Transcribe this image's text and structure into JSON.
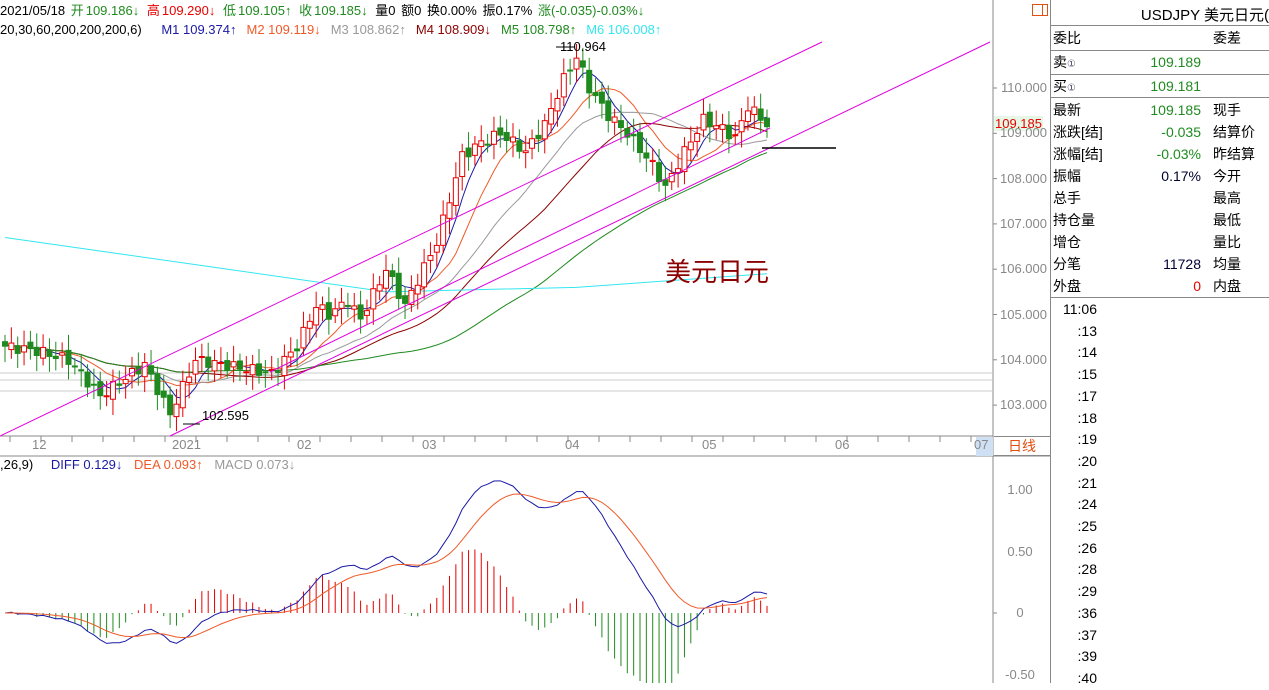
{
  "header": {
    "date": "2021/05/18",
    "open_label": "开",
    "open": "109.186↓",
    "high_label": "高",
    "high": "109.290↓",
    "low_label": "低",
    "low": "109.105↑",
    "close_label": "收",
    "close": "109.185↓",
    "volume": "量0",
    "amount": "额0",
    "turnover": "换0.00%",
    "amplitude": "振0.17%",
    "change": "涨(-0.035)-0.03%↓"
  },
  "ma_legend": {
    "params": "20,30,60,200,200,200,6)",
    "items": [
      {
        "label": "M1 109.374↑",
        "color": "#1a1aa6"
      },
      {
        "label": "M2 109.119↓",
        "color": "#f05a28"
      },
      {
        "label": "M3 108.862↑",
        "color": "#999999"
      },
      {
        "label": "M4 108.909↓",
        "color": "#8b0000"
      },
      {
        "label": "M5 108.798↑",
        "color": "#1f8a1f"
      },
      {
        "label": "M6 106.008↑",
        "color": "#33e6f0"
      }
    ]
  },
  "macd_legend": {
    "params": ",26,9)",
    "diff": "DIFF 0.129↓",
    "dea": "DEA 0.093↑",
    "macd": "MACD 0.073↓"
  },
  "annotations": {
    "high": "110.964",
    "low": "102.595",
    "watermark": "美元日元",
    "current_price": "109.185",
    "period": "日线"
  },
  "chart_data": {
    "type": "candlestick",
    "price_axis": [
      "110.000",
      "109.000",
      "108.000",
      "107.000",
      "106.000",
      "105.000",
      "104.000",
      "103.000"
    ],
    "price_axis_values": [
      110,
      109,
      108,
      107,
      106,
      105,
      104,
      103
    ],
    "macd_axis": [
      "1.00",
      "0.50",
      "0",
      "-0.50"
    ],
    "macd_axis_values": [
      1,
      0.5,
      0,
      -0.5
    ],
    "x_labels": [
      "12",
      "2021",
      "02",
      "03",
      "04",
      "05",
      "06",
      "07"
    ],
    "close_keypoints": [
      [
        0,
        104.3
      ],
      [
        5,
        104.2
      ],
      [
        10,
        104.0
      ],
      [
        15,
        103.2
      ],
      [
        22,
        103.9
      ],
      [
        26,
        102.8
      ],
      [
        30,
        104.0
      ],
      [
        38,
        103.8
      ],
      [
        42,
        103.7
      ],
      [
        46,
        104.3
      ],
      [
        49,
        105.2
      ],
      [
        51,
        105.0
      ],
      [
        54,
        105.3
      ],
      [
        56,
        104.9
      ],
      [
        60,
        106.0
      ],
      [
        63,
        105.2
      ],
      [
        68,
        106.6
      ],
      [
        72,
        108.5
      ],
      [
        75,
        108.8
      ],
      [
        78,
        109.0
      ],
      [
        82,
        108.6
      ],
      [
        85,
        109.2
      ],
      [
        88,
        110.2
      ],
      [
        90,
        110.7
      ],
      [
        92,
        110.0
      ],
      [
        95,
        109.4
      ],
      [
        98,
        109.0
      ],
      [
        102,
        108.3
      ],
      [
        104,
        107.8
      ],
      [
        107,
        108.6
      ],
      [
        110,
        109.3
      ],
      [
        113,
        109.1
      ],
      [
        115,
        108.9
      ],
      [
        117,
        109.6
      ],
      [
        120,
        109.2
      ]
    ],
    "cyan_ma_keypoints": [
      [
        0,
        106.7
      ],
      [
        30,
        106.1
      ],
      [
        60,
        105.5
      ],
      [
        90,
        105.6
      ],
      [
        120,
        105.9
      ]
    ],
    "colors": {
      "up": "#e60000",
      "down": "#1f8a1f",
      "channel": "#e000e0"
    }
  },
  "panel": {
    "title": "USDJPY 美元日元(",
    "rows1": [
      {
        "l": "委比",
        "r": "委差"
      }
    ],
    "sell": {
      "l": "卖",
      "v": "109.189"
    },
    "buy": {
      "l": "买",
      "v": "109.181"
    },
    "rows": [
      {
        "l": "最新",
        "v": "109.185",
        "r": "现手",
        "c": "#1f8a1f"
      },
      {
        "l": "涨跌[结]",
        "v": "-0.035",
        "r": "结算价",
        "c": "#1f8a1f"
      },
      {
        "l": "涨幅[结]",
        "v": "-0.03%",
        "r": "昨结算",
        "c": "#1f8a1f"
      },
      {
        "l": "振幅",
        "v": "0.17%",
        "r": "今开",
        "c": "#000033"
      },
      {
        "l": "总手",
        "v": "",
        "r": "最高",
        "c": "#000"
      },
      {
        "l": "持仓量",
        "v": "",
        "r": "最低",
        "c": "#000"
      },
      {
        "l": "增仓",
        "v": "",
        "r": "量比",
        "c": "#000"
      },
      {
        "l": "分笔",
        "v": "11728",
        "r": "均量",
        "c": "#000033"
      },
      {
        "l": "外盘",
        "v": "0",
        "r": "内盘",
        "c": "#e60000"
      }
    ],
    "ticks": [
      "11:06",
      ":13",
      ":14",
      ":15",
      ":17",
      ":18",
      ":19",
      ":20",
      ":21",
      ":24",
      ":25",
      ":26",
      ":28",
      ":29",
      ":36",
      ":37",
      ":39",
      ":40"
    ]
  }
}
